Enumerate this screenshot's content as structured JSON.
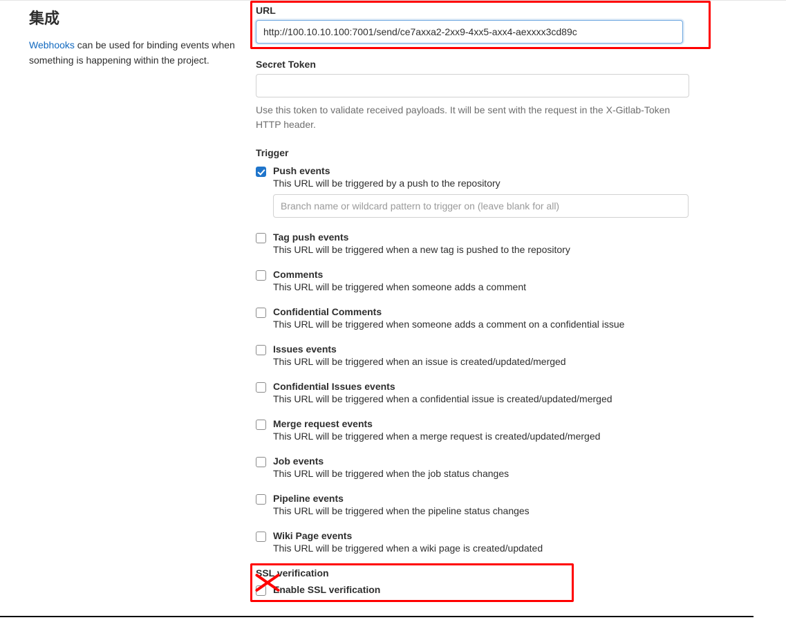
{
  "sidebar": {
    "title": "集成",
    "link_text": "Webhooks",
    "desc_rest": " can be used for binding events when something is happening within the project."
  },
  "url": {
    "label": "URL",
    "value": "http://100.10.10.100:7001/send/ce7axxa2-2xx9-4xx5-axx4-aexxxx3cd89c"
  },
  "secret": {
    "label": "Secret Token",
    "value": "",
    "help": "Use this token to validate received payloads. It will be sent with the request in the X-Gitlab-Token HTTP header."
  },
  "trigger": {
    "label": "Trigger",
    "branch_placeholder": "Branch name or wildcard pattern to trigger on (leave blank for all)",
    "items": [
      {
        "title": "Push events",
        "desc": "This URL will be triggered by a push to the repository",
        "checked": true,
        "has_branch_input": true
      },
      {
        "title": "Tag push events",
        "desc": "This URL will be triggered when a new tag is pushed to the repository",
        "checked": false
      },
      {
        "title": "Comments",
        "desc": "This URL will be triggered when someone adds a comment",
        "checked": false
      },
      {
        "title": "Confidential Comments",
        "desc": "This URL will be triggered when someone adds a comment on a confidential issue",
        "checked": false
      },
      {
        "title": "Issues events",
        "desc": "This URL will be triggered when an issue is created/updated/merged",
        "checked": false
      },
      {
        "title": "Confidential Issues events",
        "desc": "This URL will be triggered when a confidential issue is created/updated/merged",
        "checked": false
      },
      {
        "title": "Merge request events",
        "desc": "This URL will be triggered when a merge request is created/updated/merged",
        "checked": false
      },
      {
        "title": "Job events",
        "desc": "This URL will be triggered when the job status changes",
        "checked": false
      },
      {
        "title": "Pipeline events",
        "desc": "This URL will be triggered when the pipeline status changes",
        "checked": false
      },
      {
        "title": "Wiki Page events",
        "desc": "This URL will be triggered when a wiki page is created/updated",
        "checked": false
      }
    ]
  },
  "ssl": {
    "label": "SSL verification",
    "item": {
      "title": "Enable SSL verification",
      "checked": false
    }
  }
}
